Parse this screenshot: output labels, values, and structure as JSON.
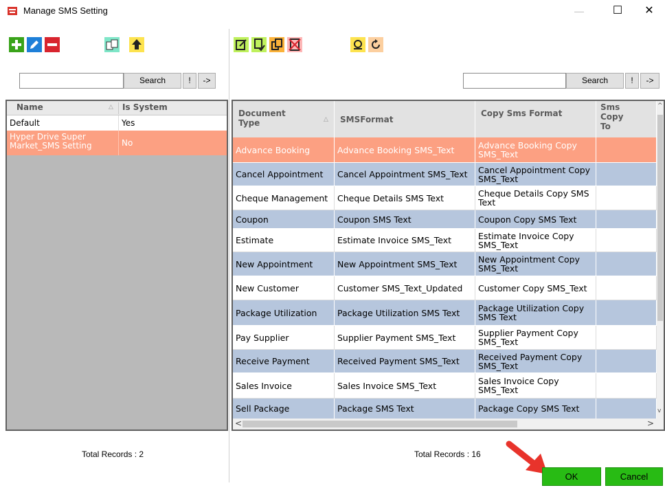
{
  "window": {
    "title": "Manage SMS Setting",
    "minimize": "—",
    "maximize": "☐",
    "close": "✕"
  },
  "left_toolbar": {
    "icons": [
      "add-icon",
      "edit-icon",
      "delete-icon",
      "copy-settings-icon",
      "upload-icon"
    ]
  },
  "right_toolbar": {
    "icons": [
      "edit-doc-icon",
      "add-doc-icon",
      "copy-doc-icon",
      "delete-doc-icon",
      "refresh-icon",
      "rotate-icon"
    ]
  },
  "left_search": {
    "value": "",
    "search_label": "Search",
    "bang_label": "!",
    "arrow_label": "->"
  },
  "right_search": {
    "value": "",
    "search_label": "Search",
    "bang_label": "!",
    "arrow_label": "->"
  },
  "left_grid": {
    "columns": [
      "Name",
      "Is System"
    ],
    "rows": [
      {
        "name": "Default",
        "is_system": "Yes"
      },
      {
        "name": "Hyper Drive Super Market_SMS Setting",
        "is_system": "No"
      }
    ]
  },
  "right_grid": {
    "columns": [
      "Document Type",
      "SMSFormat",
      "Copy Sms Format",
      "Sms Copy To"
    ],
    "rows": [
      {
        "doc": "Advance Booking",
        "fmt": "Advance Booking SMS_Text",
        "copy": "Advance Booking Copy SMS_Text"
      },
      {
        "doc": "Cancel Appointment",
        "fmt": "Cancel Appointment SMS_Text",
        "copy": "Cancel Appointment Copy SMS_Text"
      },
      {
        "doc": "Cheque Management",
        "fmt": "Cheque Details SMS Text",
        "copy": "Cheque Details Copy SMS Text"
      },
      {
        "doc": "Coupon",
        "fmt": "Coupon SMS Text",
        "copy": "Coupon Copy SMS Text"
      },
      {
        "doc": "Estimate",
        "fmt": "Estimate Invoice SMS_Text",
        "copy": "Estimate Invoice Copy SMS_Text"
      },
      {
        "doc": "New Appointment",
        "fmt": "New Appointment SMS_Text",
        "copy": "New Appointment Copy SMS_Text"
      },
      {
        "doc": "New Customer",
        "fmt": "Customer SMS_Text_Updated",
        "copy": "Customer Copy SMS_Text"
      },
      {
        "doc": "Package Utilization",
        "fmt": "Package Utilization SMS Text",
        "copy": "Package Utilization Copy SMS Text"
      },
      {
        "doc": "Pay Supplier",
        "fmt": "Supplier Payment SMS_Text",
        "copy": "Supplier Payment Copy SMS_Text"
      },
      {
        "doc": "Receive Payment",
        "fmt": "Received Payment SMS_Text",
        "copy": "Received Payment Copy SMS_Text"
      },
      {
        "doc": "Sales Invoice",
        "fmt": "Sales Invoice SMS_Text",
        "copy": "Sales Invoice Copy SMS_Text"
      },
      {
        "doc": "Sell Package",
        "fmt": "Package SMS Text",
        "copy": "Package Copy SMS Text"
      }
    ],
    "scroll_left": "<",
    "scroll_right": ">"
  },
  "footer": {
    "left_total": "Total Records : 2",
    "right_total": "Total Records : 16",
    "ok_label": "OK",
    "cancel_label": "Cancel"
  },
  "colors": {
    "selected_row": "#fca082",
    "alt_row": "#b6c6dd",
    "button_green": "#28bb14",
    "arrow_red": "#e8332b"
  }
}
